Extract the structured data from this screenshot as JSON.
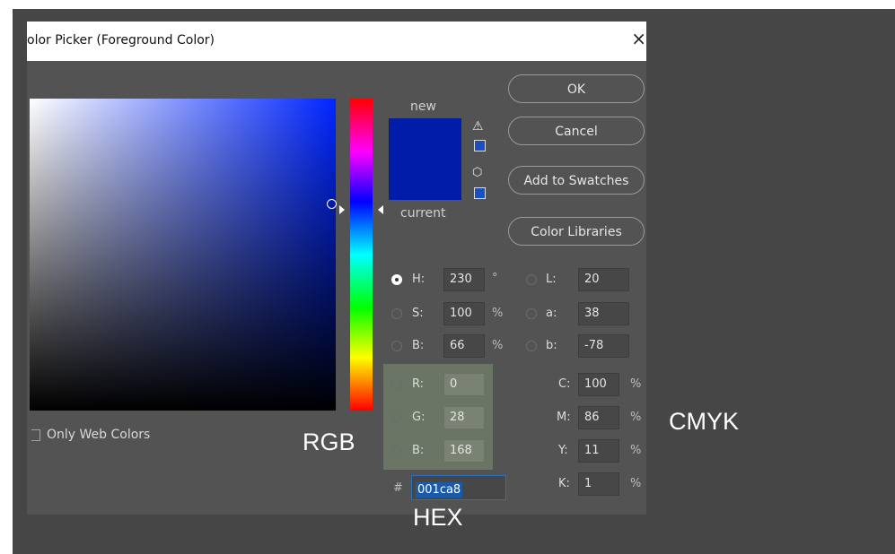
{
  "dialog": {
    "title": "olor Picker (Foreground Color)",
    "close": "×"
  },
  "colors": {
    "new": "#001ca8",
    "current": "#001ca8"
  },
  "labels": {
    "new": "new",
    "current": "current"
  },
  "icons": {
    "gamut_warning": "warning-triangle-icon",
    "web_safe": "cube-icon"
  },
  "buttons": {
    "ok": "OK",
    "cancel": "Cancel",
    "add_to_swatches": "Add to Swatches",
    "color_libraries": "Color Libraries"
  },
  "hsb": {
    "h": {
      "label": "H:",
      "value": "230",
      "unit": "°",
      "selected": true
    },
    "s": {
      "label": "S:",
      "value": "100",
      "unit": "%"
    },
    "b": {
      "label": "B:",
      "value": "66",
      "unit": "%"
    }
  },
  "lab": {
    "l": {
      "label": "L:",
      "value": "20"
    },
    "a": {
      "label": "a:",
      "value": "38"
    },
    "b": {
      "label": "b:",
      "value": "-78"
    }
  },
  "rgb": {
    "r": {
      "label": "R:",
      "value": "0"
    },
    "g": {
      "label": "G:",
      "value": "28"
    },
    "b": {
      "label": "B:",
      "value": "168"
    }
  },
  "cmyk": {
    "c": {
      "label": "C:",
      "value": "100",
      "unit": "%"
    },
    "m": {
      "label": "M:",
      "value": "86",
      "unit": "%"
    },
    "y": {
      "label": "Y:",
      "value": "11",
      "unit": "%"
    },
    "k": {
      "label": "K:",
      "value": "1",
      "unit": "%"
    }
  },
  "hex": {
    "prefix": "#",
    "value": "001ca8"
  },
  "only_web_colors": "Only Web Colors",
  "annotations": {
    "rgb": "RGB",
    "cmyk": "CMYK",
    "hex": "HEX"
  }
}
